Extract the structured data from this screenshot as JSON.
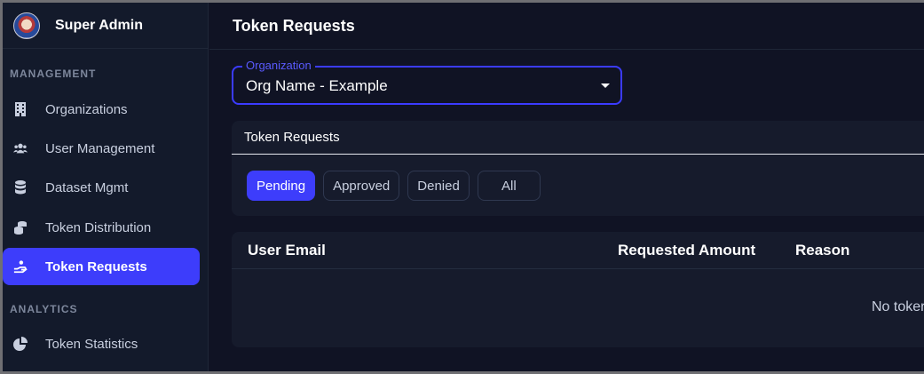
{
  "brand": {
    "name": "Super Admin"
  },
  "sidebar": {
    "sections": [
      {
        "label": "MANAGEMENT"
      },
      {
        "label": "ANALYTICS"
      }
    ],
    "items": [
      {
        "label": "Organizations",
        "icon": "building-icon"
      },
      {
        "label": "User Management",
        "icon": "users-icon"
      },
      {
        "label": "Dataset Mgmt",
        "icon": "database-icon"
      },
      {
        "label": "Token Distribution",
        "icon": "coins-icon"
      },
      {
        "label": "Token Requests",
        "icon": "hand-coin-icon",
        "active": true
      },
      {
        "label": "Token Statistics",
        "icon": "pie-chart-icon"
      }
    ]
  },
  "header": {
    "title": "Token Requests"
  },
  "organization": {
    "label": "Organization",
    "value": "Org Name - Example"
  },
  "requests": {
    "title": "Token Requests",
    "filters": [
      "Pending",
      "Approved",
      "Denied",
      "All"
    ],
    "active_filter": "Pending"
  },
  "table": {
    "columns": [
      "User Email",
      "Requested Amount",
      "Reason"
    ],
    "empty_message": "No toker"
  },
  "colors": {
    "accent": "#3d3dfb",
    "background": "#101324",
    "sidebar": "#131a2b"
  }
}
